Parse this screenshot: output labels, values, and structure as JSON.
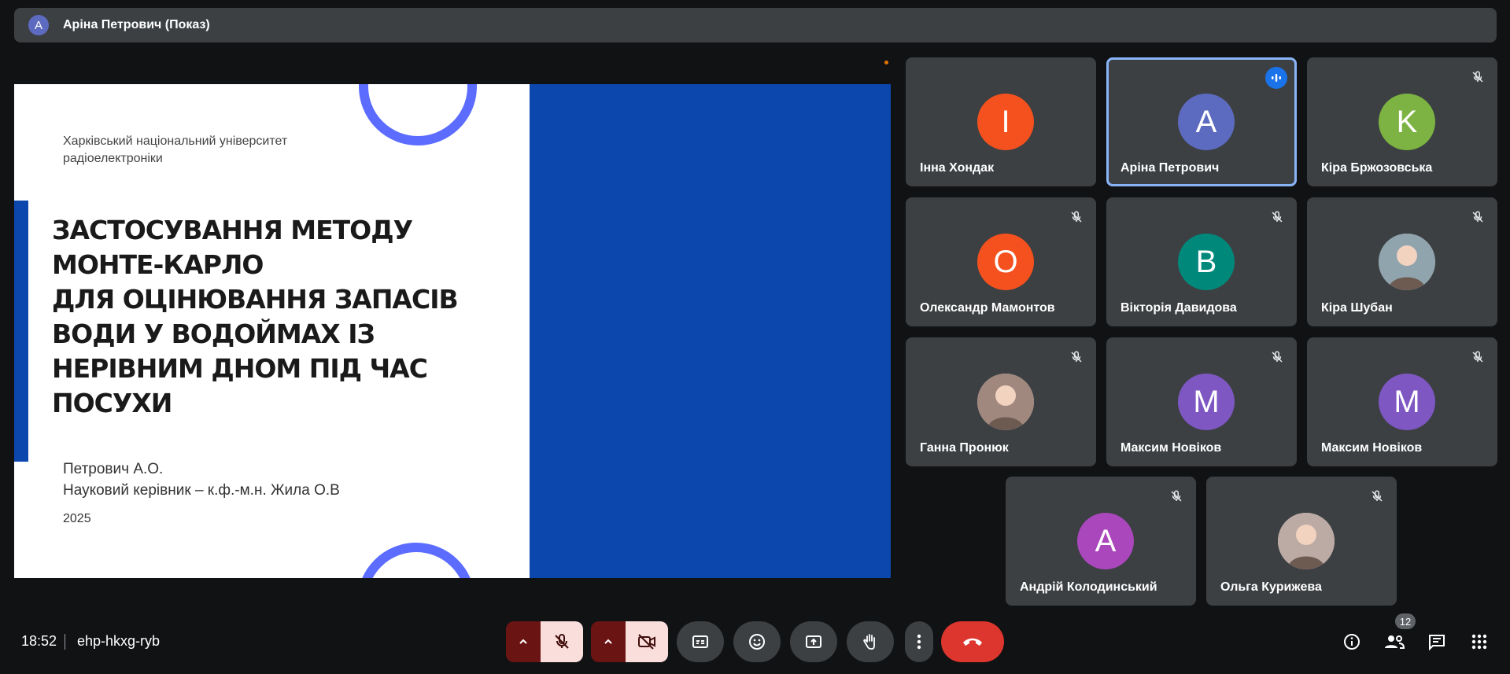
{
  "topbar": {
    "avatar_letter": "A",
    "title": "Аріна Петрович (Показ)"
  },
  "slide": {
    "university": "Харківський національний університет радіоелектроніки",
    "title_lines": [
      "Застосування методу",
      "Монте-Карло",
      "для оцінювання запасів",
      "води у водоймах із",
      "нерівним дном під час",
      "посухи"
    ],
    "author": "Петрович А.О.",
    "supervisor": "Науковий керівник – к.ф.-м.н. Жила О.В",
    "year": "2025"
  },
  "participants": [
    {
      "name": "Інна Хондак",
      "letter": "I",
      "color": "#f4511e",
      "state": "none"
    },
    {
      "name": "Аріна Петрович",
      "letter": "A",
      "color": "#5c6bc0",
      "state": "speaking"
    },
    {
      "name": "Кіра Бржозовська",
      "letter": "K",
      "color": "#7cb342",
      "state": "muted"
    },
    {
      "name": "Олександр Мамонтов",
      "letter": "O",
      "color": "#f4511e",
      "state": "muted"
    },
    {
      "name": "Вікторія Давидова",
      "letter": "B",
      "color": "#00897b",
      "state": "muted"
    },
    {
      "name": "Кіра Шубан",
      "letter": "",
      "color": "#90a4ae",
      "state": "muted",
      "photo": true
    },
    {
      "name": "Ганна Пронюк",
      "letter": "",
      "color": "#a1887f",
      "state": "muted",
      "photo": true
    },
    {
      "name": "Максим Новіков",
      "letter": "M",
      "color": "#7e57c2",
      "state": "muted"
    },
    {
      "name": "Максим Новіков",
      "letter": "M",
      "color": "#7e57c2",
      "state": "muted"
    },
    {
      "name": "Андрій Колодинський",
      "letter": "A",
      "color": "#ab47bc",
      "state": "muted"
    },
    {
      "name": "Ольга Курижева",
      "letter": "",
      "color": "#bcaaa4",
      "state": "muted",
      "photo": true
    }
  ],
  "bottombar": {
    "time": "18:52",
    "meeting_code": "ehp-hkxg-ryb",
    "people_count": "12"
  }
}
